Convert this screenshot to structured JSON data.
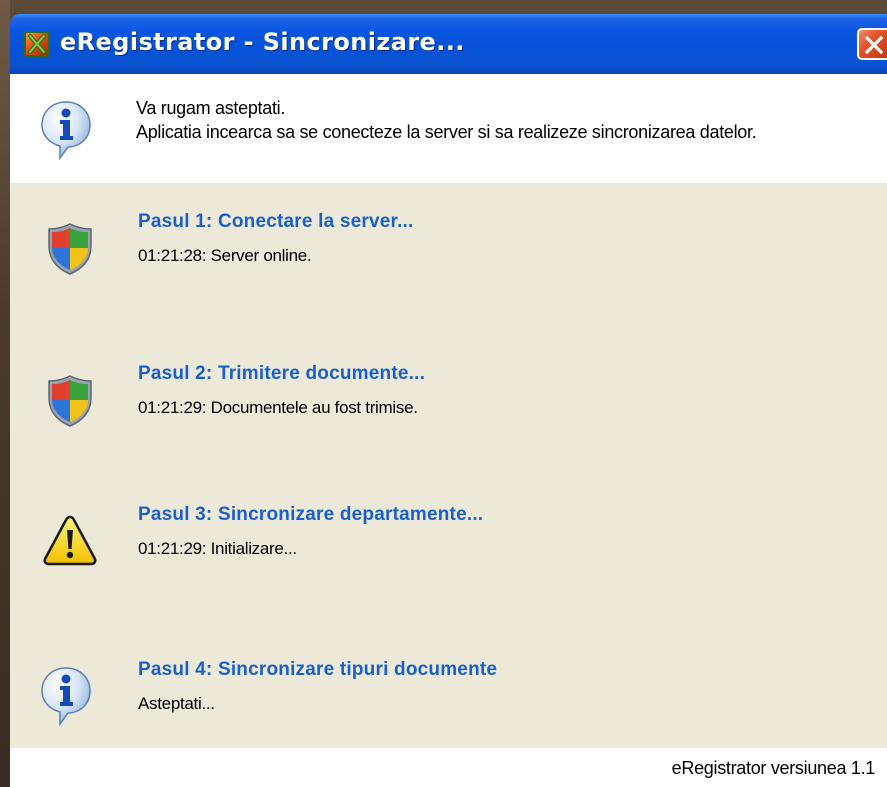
{
  "window": {
    "title": "eRegistrator - Sincronizare...",
    "app_icon": "eregistrator-app-icon",
    "close_icon": "close-icon",
    "colors": {
      "titlebar": "#0a55df",
      "close_button": "#e2542a",
      "step_title": "#1a5fcf",
      "steps_background": "#ece9d8"
    }
  },
  "header": {
    "icon": "info-icon",
    "line1": "Va rugam asteptati.",
    "line2": "Aplicatia incearca sa se conecteze la server si sa realizeze sincronizarea datelor."
  },
  "steps": [
    {
      "icon": "security-shield-icon",
      "title": "Pasul 1: Conectare la server...",
      "status": "01:21:28: Server online."
    },
    {
      "icon": "security-shield-icon",
      "title": "Pasul 2: Trimitere documente...",
      "status": "01:21:29: Documentele au fost trimise."
    },
    {
      "icon": "warning-icon",
      "title": "Pasul 3: Sincronizare departamente...",
      "status": "01:21:29: Initializare..."
    },
    {
      "icon": "info-icon",
      "title": "Pasul 4: Sincronizare tipuri documente",
      "status": "Asteptati..."
    }
  ],
  "footer": {
    "version": "eRegistrator versiunea 1.1"
  }
}
